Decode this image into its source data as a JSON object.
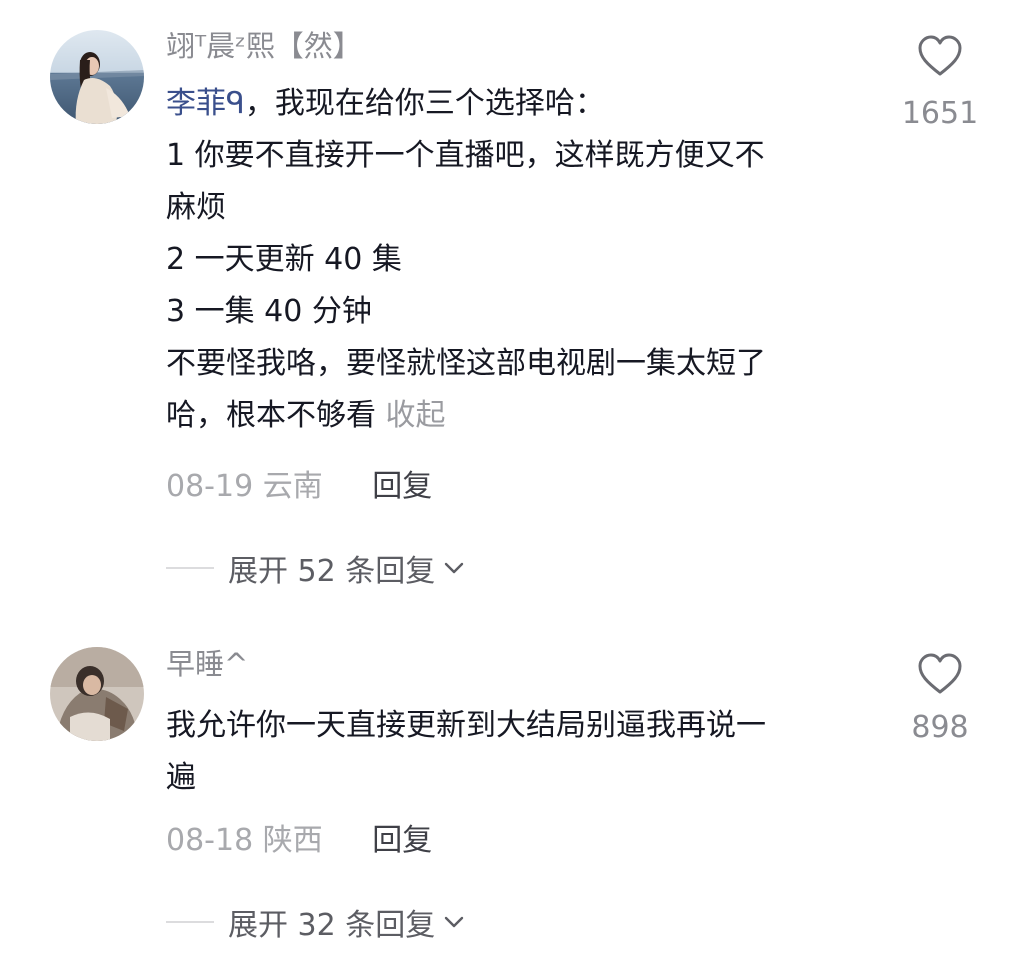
{
  "comments": [
    {
      "username": "翊ᵀ晨ᶻ熙【然】",
      "mention": "李菲ᑫ",
      "lines": [
        "，我现在给你三个选择哈：",
        "1 你要不直接开一个直播吧，这样既方便又不",
        "麻烦",
        "2 一天更新 40 集",
        "3 一集 40 分钟",
        "不要怪我咯，要怪就怪这部电视剧一集太短了",
        "哈，根本不够看"
      ],
      "collapse_label": "收起",
      "date": "08-19",
      "location": "云南",
      "reply_label": "回复",
      "expand_label": "展开 52 条回复",
      "likes": "1651",
      "icons": {
        "like": "heart-outline-icon",
        "expand": "chevron-down-icon"
      }
    },
    {
      "username": "早睡^",
      "lines": [
        "我允许你一天直接更新到大结局别逼我再说一",
        "遍"
      ],
      "date": "08-18",
      "location": "陕西",
      "reply_label": "回复",
      "expand_label": "展开 32 条回复",
      "likes": "898",
      "icons": {
        "like": "heart-outline-icon",
        "expand": "chevron-down-icon"
      }
    }
  ],
  "colors": {
    "username": "#8a8b91",
    "mention": "#3a4f8c",
    "body_text": "#161823",
    "meta_text": "#a8a9ad",
    "reply_text": "#3f4047",
    "expand_text": "#5c5d63"
  }
}
